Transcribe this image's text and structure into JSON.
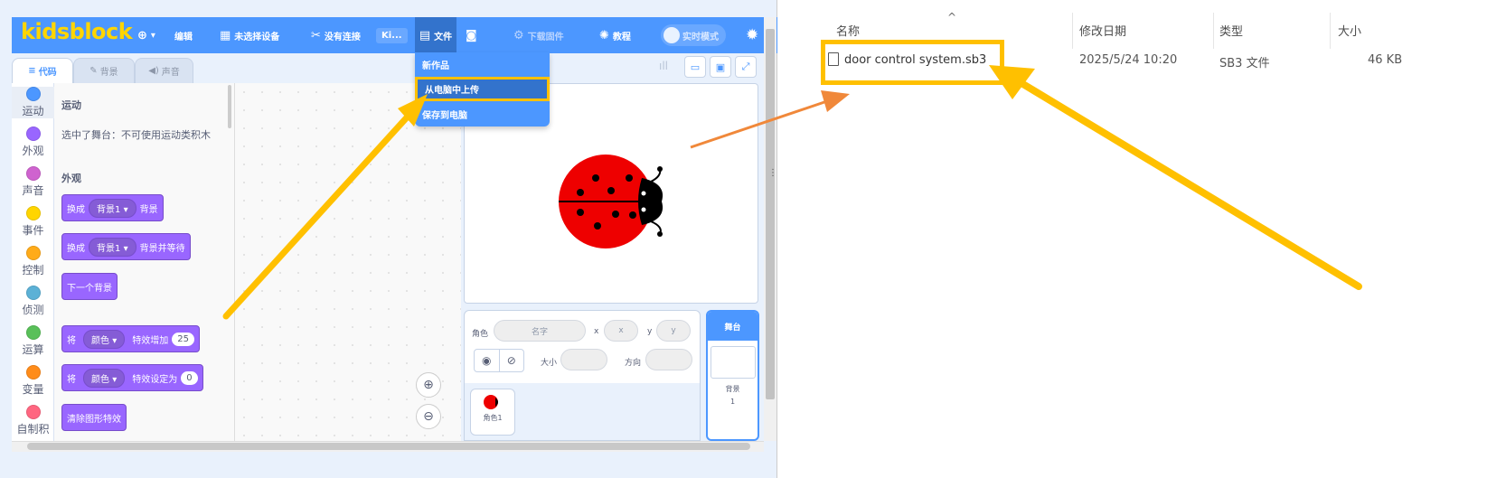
{
  "app": {
    "logo": "kidsblock",
    "menu": {
      "globe_caret": "▾",
      "edit": "编辑",
      "device": "未选择设备",
      "connection": "没有连接",
      "project_short": "Ki...",
      "file": "文件",
      "download_firmware": "下载固件",
      "tutorial": "教程",
      "realtime": "实时模式"
    },
    "tabs": {
      "code": "代码",
      "backdrop": "背景",
      "sound": "声音"
    },
    "categories": [
      {
        "label": "运动",
        "color": "#4c97ff"
      },
      {
        "label": "外观",
        "color": "#9966ff"
      },
      {
        "label": "声音",
        "color": "#cf63cf"
      },
      {
        "label": "事件",
        "color": "#ffd500"
      },
      {
        "label": "控制",
        "color": "#ffab19"
      },
      {
        "label": "侦测",
        "color": "#5cb1d6"
      },
      {
        "label": "运算",
        "color": "#59c059"
      },
      {
        "label": "变量",
        "color": "#ff8c1a"
      },
      {
        "label": "自制积",
        "color": "#ff6680"
      }
    ],
    "palette": {
      "motion_title": "运动",
      "motion_note": "选中了舞台：不可使用运动类积木",
      "looks_title": "外观",
      "b1": {
        "pre": "换成",
        "dd": "背景1",
        "post": "背景"
      },
      "b2": {
        "pre": "换成",
        "dd": "背景1",
        "post": "背景并等待"
      },
      "b3": {
        "text": "下一个背景"
      },
      "b4": {
        "pre": "将",
        "dd": "颜色",
        "post": "特效增加",
        "num": "25"
      },
      "b5": {
        "pre": "将",
        "dd": "颜色",
        "post": "特效设定为",
        "num": "0"
      },
      "b6": {
        "text": "清除图形特效"
      },
      "dd_caret": "▾"
    },
    "file_menu": {
      "new": "新作品",
      "upload": "从电脑中上传",
      "save": "保存到电脑"
    },
    "sprite_info": {
      "sprite_label": "角色",
      "name_placeholder": "名字",
      "x_label": "x",
      "x_placeholder": "x",
      "y_label": "y",
      "y_placeholder": "y",
      "size_label": "大小",
      "direction_label": "方向",
      "sprite1": "角色1"
    },
    "stage_panel": {
      "title": "舞台",
      "backdrop_label": "背景",
      "backdrop_count": "1"
    }
  },
  "explorer": {
    "headers": {
      "name": "名称",
      "modified": "修改日期",
      "type": "类型",
      "size": "大小"
    },
    "files": [
      {
        "name": "door control system.sb3",
        "modified": "2025/5/24 10:20",
        "type": "SB3 文件",
        "size": "46 KB"
      }
    ]
  },
  "colors": {
    "brand": "#4c97ff",
    "logo": "#ffd500",
    "highlight": "#ffc000",
    "arrow_orange": "#f0883a"
  }
}
